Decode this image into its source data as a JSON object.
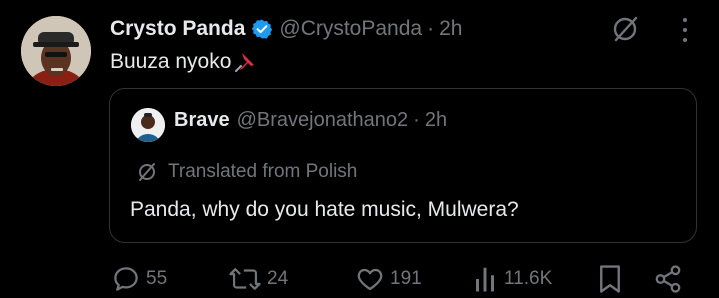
{
  "post": {
    "author": {
      "display_name": "Crysto Panda",
      "handle": "@CrystoPanda",
      "verified": true,
      "time": "2h"
    },
    "text": "Buuza nyoko",
    "text_emoji": "pin-emoji"
  },
  "quote": {
    "author": {
      "display_name": "Brave",
      "handle": "@Bravejonathano2",
      "time": "2h"
    },
    "translated_label": "Translated from Polish",
    "text": "Panda, why do you hate music, Mulwera?"
  },
  "actions": {
    "replies": "55",
    "reposts": "24",
    "likes": "191",
    "views": "11.6K"
  },
  "separator": "·",
  "colors": {
    "background": "#000000",
    "primary_text": "#e7e9ea",
    "secondary_text": "#71767b",
    "border": "#2f3336",
    "verified_blue": "#1d9bf0"
  }
}
